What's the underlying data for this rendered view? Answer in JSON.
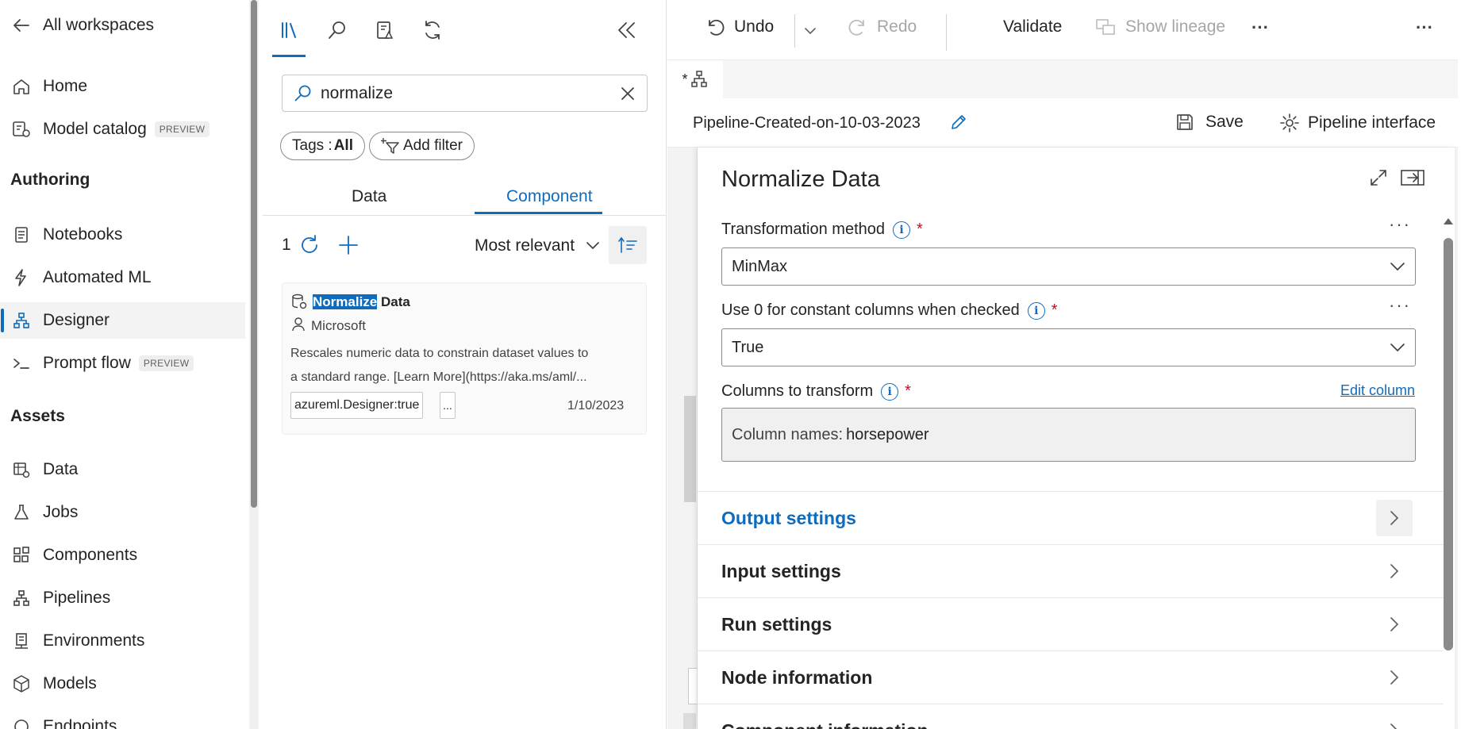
{
  "leftnav": {
    "back_label": "All workspaces",
    "home": "Home",
    "model_catalog": "Model catalog",
    "model_catalog_badge": "PREVIEW",
    "authoring_header": "Authoring",
    "notebooks": "Notebooks",
    "automated_ml": "Automated ML",
    "designer": "Designer",
    "prompt_flow": "Prompt flow",
    "prompt_flow_badge": "PREVIEW",
    "assets_header": "Assets",
    "data": "Data",
    "jobs": "Jobs",
    "components": "Components",
    "pipelines": "Pipelines",
    "environments": "Environments",
    "models": "Models",
    "endpoints_partial": "Endpoints"
  },
  "library": {
    "search_value": "normalize",
    "tags_label": "Tags : ",
    "tags_value": "All",
    "add_filter": "Add filter",
    "tabs": [
      "Data",
      "Component"
    ],
    "active_tab": "Component",
    "result_count": "1",
    "sort_label": "Most relevant",
    "card": {
      "title_highlight": "Normalize",
      "title_rest": " Data",
      "author": "Microsoft",
      "desc_line1": "Rescales numeric data to constrain dataset values to",
      "desc_line2": "a standard range. [Learn More](https://aka.ms/aml/...",
      "tag": "azureml.Designer:true",
      "more_tag": "...",
      "date": "1/10/2023"
    }
  },
  "toolbar": {
    "undo": "Undo",
    "redo": "Redo",
    "validate": "Validate",
    "show_lineage": "Show lineage",
    "more": "···"
  },
  "pipeline": {
    "tab_marker": "*",
    "name": "Pipeline-Created-on-10-03-2023",
    "save": "Save",
    "interface": "Pipeline interface"
  },
  "props": {
    "title": "Normalize Data",
    "transformation_label": "Transformation method",
    "transformation_value": "MinMax",
    "constant_label": "Use 0 for constant columns when checked",
    "constant_value": "True",
    "columns_label": "Columns to transform",
    "edit_column": "Edit column",
    "columns_prefix": "Column names: ",
    "columns_value": "horsepower",
    "sections": [
      "Output settings",
      "Input settings",
      "Run settings",
      "Node information",
      "Component information"
    ]
  },
  "colors": {
    "accent": "#0f6cbd",
    "required": "#c50f1f",
    "selection": "#0f6cbd"
  }
}
